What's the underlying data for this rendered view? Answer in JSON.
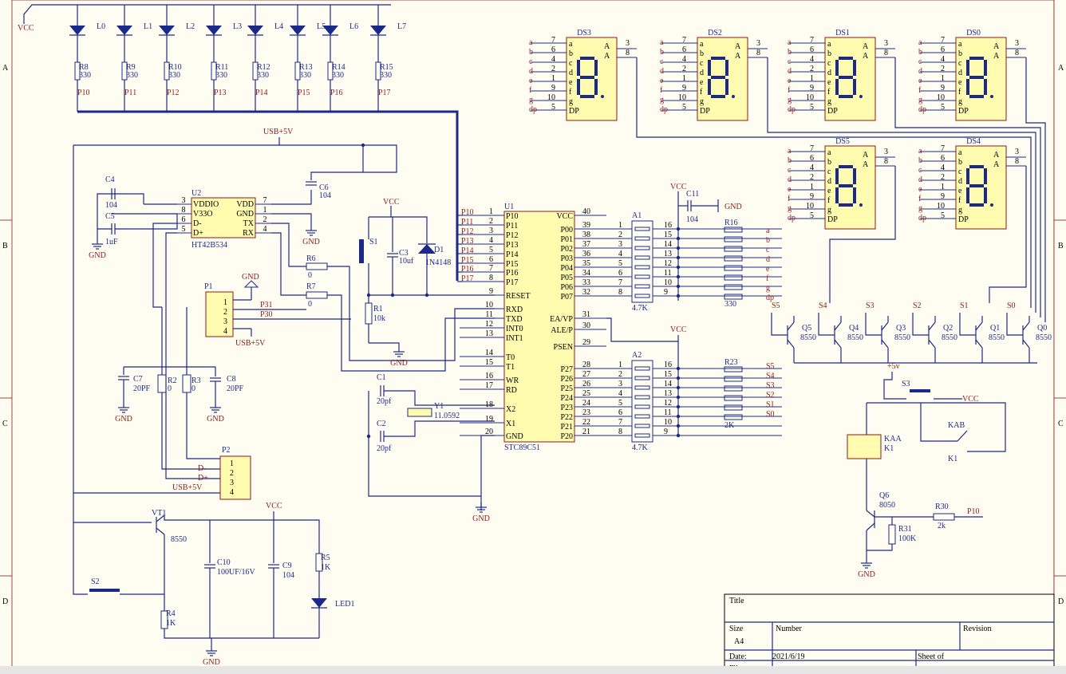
{
  "zones_left": [
    "A",
    "B",
    "C",
    "D"
  ],
  "leds": [
    {
      "ref": "L0",
      "res": "R8",
      "val": "330",
      "net": "P10"
    },
    {
      "ref": "L1",
      "res": "R9",
      "val": "330",
      "net": "P11"
    },
    {
      "ref": "L2",
      "res": "R10",
      "val": "330",
      "net": "P12"
    },
    {
      "ref": "L3",
      "res": "R11",
      "val": "330",
      "net": "P13"
    },
    {
      "ref": "L4",
      "res": "R12",
      "val": "330",
      "net": "P14"
    },
    {
      "ref": "L5",
      "res": "R13",
      "val": "330",
      "net": "P15"
    },
    {
      "ref": "L6",
      "res": "R14",
      "val": "330",
      "net": "P16"
    },
    {
      "ref": "L7",
      "res": "R15",
      "val": "330",
      "net": "P17"
    }
  ],
  "power": {
    "vcc": "VCC",
    "gnd": "GND",
    "usb5v": "USB+5V",
    "p5v": "+5v"
  },
  "u2": {
    "ref": "U2",
    "part": "HT42B534",
    "left_pins": [
      "VDDIO",
      "V33O",
      "D-",
      "D+"
    ],
    "left_nums": [
      "3",
      "8",
      "6",
      "5"
    ],
    "right_pins": [
      "VDD",
      "GND",
      "TX",
      "RX"
    ],
    "right_nums": [
      "7",
      "1",
      "2",
      "4"
    ]
  },
  "caps": {
    "c4": {
      "ref": "C4",
      "val": "104"
    },
    "c5": {
      "ref": "C5",
      "val": "1uF"
    },
    "c6": {
      "ref": "C6",
      "val": "104"
    },
    "c3": {
      "ref": "C3",
      "val": "10uf"
    },
    "c7": {
      "ref": "C7",
      "val": "20PF"
    },
    "c8": {
      "ref": "C8",
      "val": "20PF"
    },
    "c1": {
      "ref": "C1",
      "val": "20pf"
    },
    "c2": {
      "ref": "C2",
      "val": "20pf"
    },
    "c11": {
      "ref": "C11",
      "val": "104"
    },
    "c10": {
      "ref": "C10",
      "val": "100UF/16V"
    },
    "c9": {
      "ref": "C9",
      "val": "104"
    }
  },
  "misc": {
    "r6": {
      "ref": "R6",
      "val": "0"
    },
    "r7": {
      "ref": "R7",
      "val": "0"
    },
    "r1": {
      "ref": "R1",
      "val": "10k"
    },
    "r2": {
      "ref": "R2",
      "val": "0"
    },
    "r3": {
      "ref": "R3",
      "val": "0"
    },
    "r5": {
      "ref": "R5",
      "val": "1K"
    },
    "r4": {
      "ref": "R4",
      "val": "1K"
    },
    "r30": {
      "ref": "R30",
      "val": "2k"
    },
    "r31": {
      "ref": "R31",
      "val": "100K"
    },
    "s1": "S1",
    "s2": "S2",
    "s3": "S3",
    "d1": {
      "ref": "D1",
      "val": "1N4148"
    },
    "y1": {
      "ref": "Y1",
      "val": "11.0592"
    },
    "p1": "P1",
    "p2": "P2",
    "vt1": {
      "ref": "VT1",
      "val": "8550"
    },
    "led1": "LED1",
    "q6": {
      "ref": "Q6",
      "val": "8050"
    },
    "k1": {
      "ref": "K1",
      "coil": "KAA",
      "sw": "KAB"
    },
    "net_p31": "P31",
    "net_p30": "P30",
    "net_p10": "P10",
    "dm": "D-",
    "dp": "D+"
  },
  "mcu": {
    "ref": "U1",
    "part": "STC89C51",
    "left": [
      {
        "n": "1",
        "p": "P10"
      },
      {
        "n": "2",
        "p": "P11"
      },
      {
        "n": "3",
        "p": "P12"
      },
      {
        "n": "4",
        "p": "P13"
      },
      {
        "n": "5",
        "p": "P14"
      },
      {
        "n": "6",
        "p": "P15"
      },
      {
        "n": "7",
        "p": "P16"
      },
      {
        "n": "8",
        "p": "P17"
      },
      {
        "n": "9",
        "p": "RESET"
      },
      {
        "n": "10",
        "p": "RXD"
      },
      {
        "n": "11",
        "p": "TXD"
      },
      {
        "n": "12",
        "p": "INT0"
      },
      {
        "n": "13",
        "p": "INT1"
      },
      {
        "n": "14",
        "p": "T0"
      },
      {
        "n": "15",
        "p": "T1"
      },
      {
        "n": "16",
        "p": "WR"
      },
      {
        "n": "17",
        "p": "RD"
      },
      {
        "n": "18",
        "p": "X2"
      },
      {
        "n": "19",
        "p": "X1"
      },
      {
        "n": "20",
        "p": "GND"
      }
    ],
    "right_top": [
      {
        "n": "40",
        "p": "VCC"
      },
      {
        "n": "39",
        "p": "P00"
      },
      {
        "n": "38",
        "p": "P01"
      },
      {
        "n": "37",
        "p": "P02"
      },
      {
        "n": "36",
        "p": "P03"
      },
      {
        "n": "35",
        "p": "P04"
      },
      {
        "n": "34",
        "p": "P05"
      },
      {
        "n": "33",
        "p": "P06"
      },
      {
        "n": "32",
        "p": "P07"
      },
      {
        "n": "31",
        "p": "EA/VP"
      },
      {
        "n": "30",
        "p": "ALE/P"
      },
      {
        "n": "29",
        "p": "PSEN"
      }
    ],
    "right_bot": [
      {
        "n": "28",
        "p": "P27"
      },
      {
        "n": "27",
        "p": "P26"
      },
      {
        "n": "26",
        "p": "P25"
      },
      {
        "n": "25",
        "p": "P24"
      },
      {
        "n": "24",
        "p": "P23"
      },
      {
        "n": "23",
        "p": "P22"
      },
      {
        "n": "22",
        "p": "P21"
      },
      {
        "n": "21",
        "p": "P20"
      }
    ]
  },
  "a1": {
    "ref": "A1",
    "val": "4.7K",
    "l": [
      "1",
      "2",
      "3",
      "4",
      "5",
      "6",
      "7",
      "8"
    ],
    "r": [
      "16",
      "15",
      "14",
      "13",
      "12",
      "11",
      "10",
      "9"
    ]
  },
  "a2": {
    "ref": "A2",
    "val": "4.7K",
    "l": [
      "1",
      "2",
      "3",
      "4",
      "5",
      "6",
      "7",
      "8"
    ],
    "r": [
      "16",
      "15",
      "14",
      "13",
      "12",
      "11",
      "10",
      "9"
    ]
  },
  "r16": {
    "ref": "R16",
    "val": "330",
    "nets": [
      "a",
      "b",
      "c",
      "d",
      "e",
      "f",
      "g",
      "dp"
    ]
  },
  "r23": {
    "ref": "R23",
    "val": "2K",
    "nets": [
      "S5",
      "S4",
      "S3",
      "S2",
      "S1",
      "S0"
    ]
  },
  "digits": [
    {
      "ref": "DS3"
    },
    {
      "ref": "DS2"
    },
    {
      "ref": "DS1"
    },
    {
      "ref": "DS0"
    },
    {
      "ref": "DS5"
    },
    {
      "ref": "DS4"
    }
  ],
  "digit_pins": {
    "segs": [
      "a",
      "b",
      "c",
      "d",
      "e",
      "f",
      "g",
      "dp"
    ],
    "nums": [
      "7",
      "6",
      "4",
      "2",
      "1",
      "9",
      "10",
      "5"
    ],
    "inside": [
      "a",
      "b",
      "c",
      "d",
      "e",
      "f",
      "g",
      "DP"
    ],
    "common": "A",
    "cnums": [
      "3",
      "8"
    ]
  },
  "transistors": [
    {
      "ref": "Q5",
      "val": "8550",
      "net": "S5"
    },
    {
      "ref": "Q4",
      "val": "8550",
      "net": "S4"
    },
    {
      "ref": "Q3",
      "val": "8550",
      "net": "S3"
    },
    {
      "ref": "Q2",
      "val": "8550",
      "net": "S2"
    },
    {
      "ref": "Q1",
      "val": "8550",
      "net": "S1"
    },
    {
      "ref": "Q0",
      "val": "8550",
      "net": "S0"
    }
  ],
  "titleblock": {
    "title": "Title",
    "size_label": "Size",
    "size": "A4",
    "number": "Number",
    "revision": "Revision",
    "date_label": "Date:",
    "date": "2021/6/19",
    "sheet": "Sheet   of",
    "file_label": "File:"
  }
}
